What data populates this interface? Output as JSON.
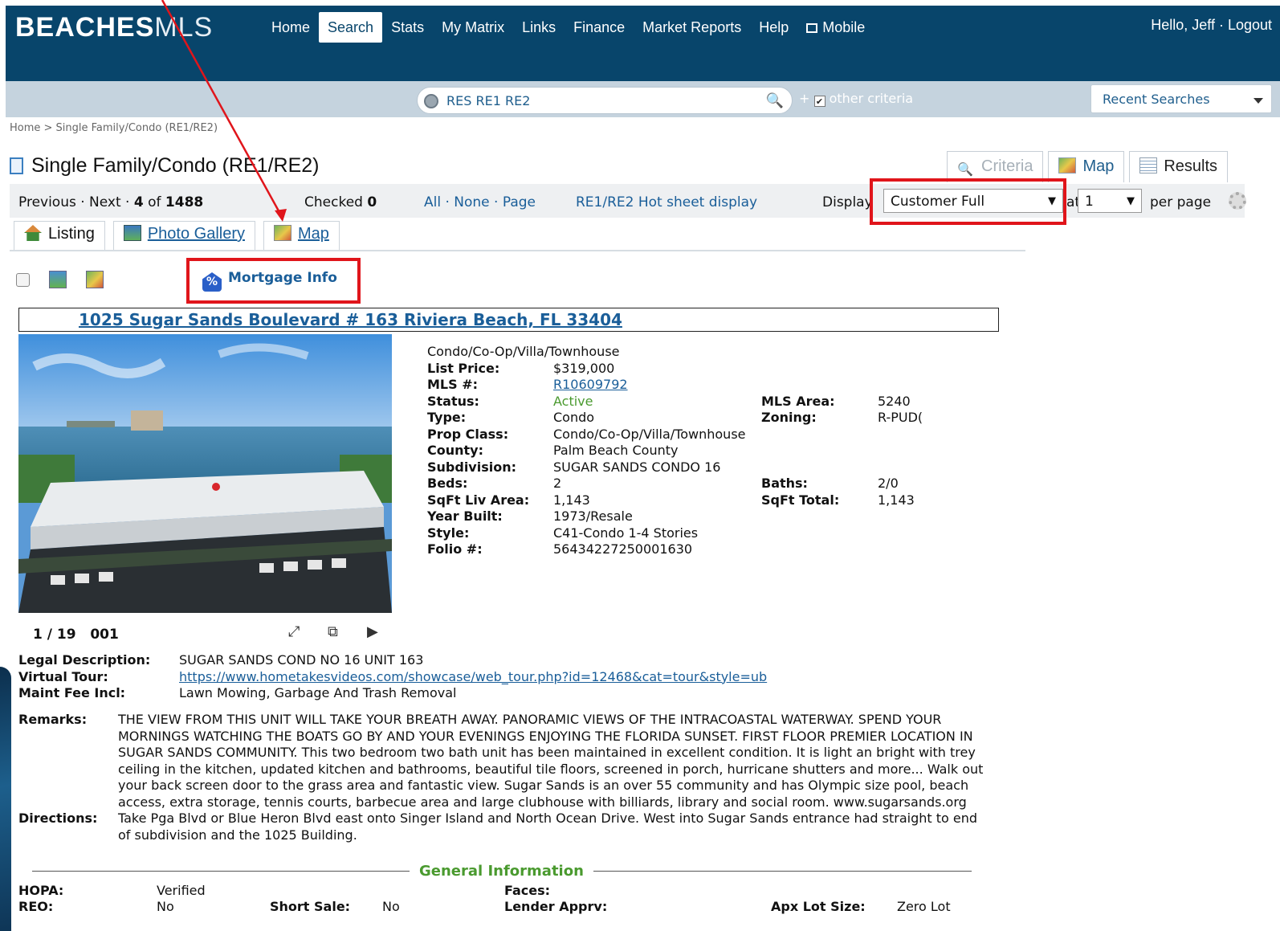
{
  "brand": {
    "logo_bold": "BEACHES",
    "logo_thin": "MLS"
  },
  "nav": {
    "items": [
      {
        "label": "Home"
      },
      {
        "label": "Search"
      },
      {
        "label": "Stats"
      },
      {
        "label": "My Matrix"
      },
      {
        "label": "Links"
      },
      {
        "label": "Finance"
      },
      {
        "label": "Market Reports"
      },
      {
        "label": "Help"
      },
      {
        "label": "Mobile"
      }
    ],
    "active": "Search",
    "greeting": "Hello, Jeff · Logout"
  },
  "search": {
    "query": "RES RE1 RE2",
    "other_criteria": "other criteria",
    "recent": "Recent Searches"
  },
  "breadcrumb": "Home > Single Family/Condo (RE1/RE2)",
  "page_title": "Single Family/Condo (RE1/RE2)",
  "view_tabs": {
    "criteria": "Criteria",
    "map": "Map",
    "results": "Results"
  },
  "toolbar": {
    "prev_next": "Previous · Next ·",
    "position": "4",
    "of": "of",
    "total": "1488",
    "checked_label": "Checked",
    "checked_count": "0",
    "all_none_page": "All · None · Page",
    "hotsheet": "RE1/RE2 Hot sheet display",
    "display_label": "Display",
    "display_value": "Customer Full",
    "at_label": "at",
    "per_page_value": "1",
    "per_page_label": "per page"
  },
  "listing_tabs": {
    "listing": "Listing",
    "photo_gallery": "Photo Gallery",
    "map": "Map"
  },
  "mortgage_info": "Mortgage Info",
  "listing": {
    "address": "1025 Sugar Sands Boulevard # 163 Riviera Beach, FL 33404",
    "category": "Condo/Co-Op/Villa/Townhouse",
    "fields_left": [
      {
        "label": "List Price:",
        "value": "$319,000"
      },
      {
        "label": "MLS #:",
        "value": "R10609792"
      },
      {
        "label": "Status:",
        "value": "Active"
      },
      {
        "label": "Type:",
        "value": "Condo"
      },
      {
        "label": "Prop Class:",
        "value": "Condo/Co-Op/Villa/Townhouse"
      },
      {
        "label": "County:",
        "value": "Palm Beach County"
      },
      {
        "label": "Subdivision:",
        "value": "SUGAR SANDS CONDO 16"
      },
      {
        "label": "Beds:",
        "value": "2"
      },
      {
        "label": "SqFt Liv Area:",
        "value": "1,143"
      },
      {
        "label": "Year Built:",
        "value": "1973/Resale"
      },
      {
        "label": "Style:",
        "value": "C41-Condo 1-4 Stories"
      },
      {
        "label": "Folio #:",
        "value": "56434227250001630"
      }
    ],
    "fields_right": [
      {
        "label": "MLS Area:",
        "value": "5240"
      },
      {
        "label": "Zoning:",
        "value": "R-PUD("
      },
      {
        "label": "Baths:",
        "value": "2/0"
      },
      {
        "label": "SqFt Total:",
        "value": "1,143"
      }
    ],
    "photo_counter": "1 / 19",
    "photo_code": "001",
    "legal_label": "Legal Description:",
    "legal_value": "SUGAR SANDS COND NO 16 UNIT 163",
    "tour_label": "Virtual Tour:",
    "tour_value": "https://www.hometakesvideos.com/showcase/web_tour.php?id=12468&cat=tour&style=ub",
    "maint_label": "Maint Fee Incl:",
    "maint_value": "Lawn Mowing, Garbage And Trash Removal",
    "remarks_label": "Remarks:",
    "remarks": "THE VIEW FROM THIS UNIT WILL TAKE YOUR BREATH AWAY. PANORAMIC VIEWS OF THE INTRACOASTAL WATERWAY. SPEND YOUR MORNINGS WATCHING THE BOATS GO BY AND YOUR EVENINGS ENJOYING THE FLORIDA SUNSET. FIRST FLOOR PREMIER LOCATION IN SUGAR SANDS COMMUNITY. This two bedroom two bath unit has been maintained in excellent condition. It is light an bright with trey ceiling in the kitchen, updated kitchen and bathrooms, beautiful tile floors, screened in porch, hurricane shutters and more... Walk out your back screen door to the grass area and fantastic view. Sugar Sands is an over 55 community and has Olympic size pool, beach access, extra storage, tennis courts, barbecue area and large clubhouse with billiards, library and social room. www.sugarsands.org",
    "directions_label": "Directions:",
    "directions": "Take Pga Blvd or Blue Heron Blvd east onto Singer Island and North Ocean Drive. West into Sugar Sands entrance had straight to end of subdivision and the 1025 Building.",
    "general_info": "General Information",
    "general": {
      "hopa_label": "HOPA:",
      "hopa": "Verified",
      "reo_label": "REO:",
      "reo": "No",
      "short_label": "Short Sale:",
      "short": "No",
      "faces_label": "Faces:",
      "lender_label": "Lender Apprv:",
      "lot_label": "Apx Lot Size:",
      "lot": "Zero Lot"
    }
  },
  "colors": {
    "header_bg": "#08456b",
    "search_bg": "#c5d3de",
    "link": "#1a5e99",
    "highlight": "#e0151b",
    "active_status": "#4a9a2f"
  }
}
